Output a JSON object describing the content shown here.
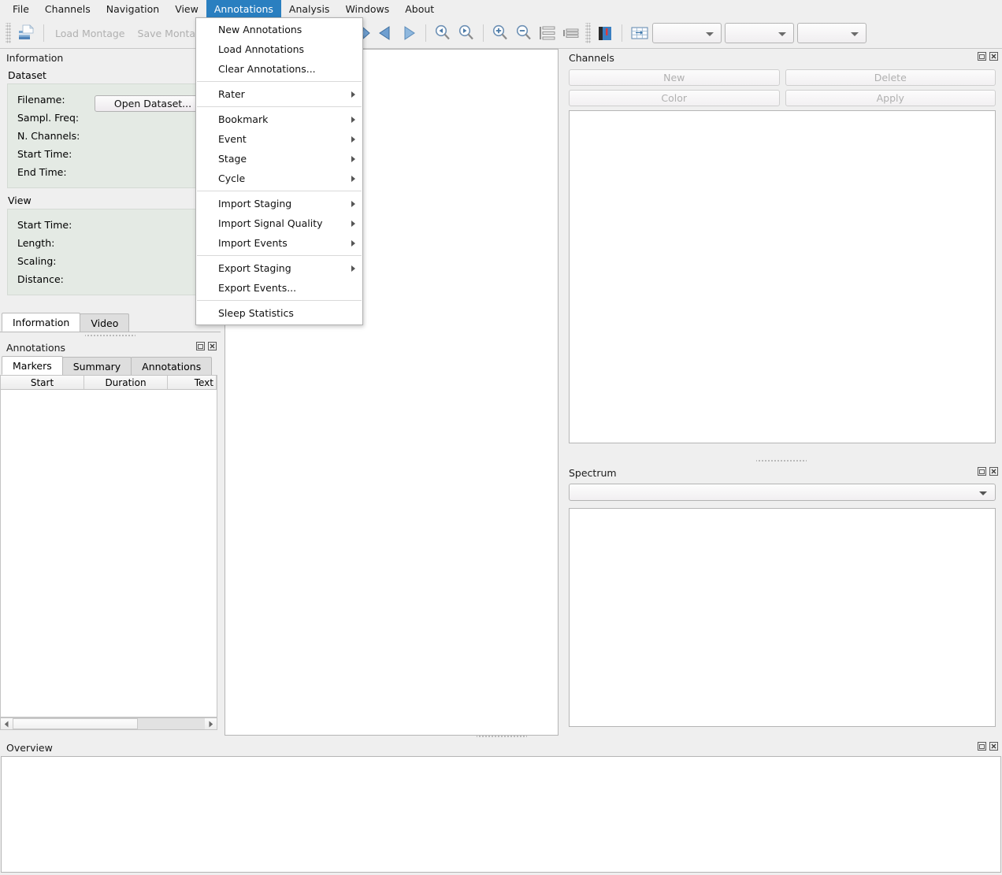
{
  "menubar": {
    "items": [
      {
        "label": "File",
        "active": false
      },
      {
        "label": "Channels",
        "active": false
      },
      {
        "label": "Navigation",
        "active": false
      },
      {
        "label": "View",
        "active": false
      },
      {
        "label": "Annotations",
        "active": true
      },
      {
        "label": "Analysis",
        "active": false
      },
      {
        "label": "Windows",
        "active": false
      },
      {
        "label": "About",
        "active": false
      }
    ],
    "highlight_color": "#2a7fc0"
  },
  "dropdown": {
    "title": "Annotations",
    "items": [
      {
        "label": "New Annotations",
        "submenu": false,
        "separator_after": false
      },
      {
        "label": "Load Annotations",
        "submenu": false,
        "separator_after": false
      },
      {
        "label": "Clear Annotations...",
        "submenu": false,
        "separator_after": true
      },
      {
        "label": "Rater",
        "submenu": true,
        "separator_after": true
      },
      {
        "label": "Bookmark",
        "submenu": true,
        "separator_after": false
      },
      {
        "label": "Event",
        "submenu": true,
        "separator_after": false
      },
      {
        "label": "Stage",
        "submenu": true,
        "separator_after": false
      },
      {
        "label": "Cycle",
        "submenu": true,
        "separator_after": true
      },
      {
        "label": "Import Staging",
        "submenu": true,
        "separator_after": false
      },
      {
        "label": "Import Signal Quality",
        "submenu": true,
        "separator_after": false
      },
      {
        "label": "Import Events",
        "submenu": true,
        "separator_after": true
      },
      {
        "label": "Export Staging",
        "submenu": true,
        "separator_after": false
      },
      {
        "label": "Export Events...",
        "submenu": false,
        "separator_after": true
      },
      {
        "label": "Sleep Statistics",
        "submenu": false,
        "separator_after": false
      }
    ]
  },
  "toolbar": {
    "open_dataset_icon": "open-dataset-icon",
    "load_montage_label": "Load Montage",
    "save_montage_label": "Save Montage",
    "annotations_label": "Load Annotations",
    "nav_back_icon": "arrow-left-big-icon",
    "nav_forward_icon": "arrow-right-big-icon",
    "step_back_icon": "triangle-left-icon",
    "step_forward_icon": "triangle-right-icon",
    "page_back_icon": "magnifier-step-back-icon",
    "page_forward_icon": "magnifier-step-forward-icon",
    "zoom_in_icon": "magnifier-plus-icon",
    "zoom_out_icon": "magnifier-minus-icon",
    "more_lines_icon": "lines-expand-icon",
    "less_lines_icon": "lines-collapse-icon",
    "amplitude_icon": "amplitude-bar-icon",
    "grid_icon": "grid-table-icon",
    "combo1_value": "",
    "combo2_value": "",
    "combo3_value": ""
  },
  "info_panel": {
    "title": "Information",
    "dataset": {
      "label": "Dataset",
      "rows": [
        {
          "key": "Filename:",
          "value": ""
        },
        {
          "key": "Sampl. Freq:",
          "value": ""
        },
        {
          "key": "N. Channels:",
          "value": ""
        },
        {
          "key": "Start Time:",
          "value": ""
        },
        {
          "key": "End Time:",
          "value": ""
        }
      ],
      "open_button": "Open Dataset..."
    },
    "view": {
      "label": "View",
      "rows": [
        {
          "key": "Start Time:",
          "value": ""
        },
        {
          "key": "Length:",
          "value": ""
        },
        {
          "key": "Scaling:",
          "value": ""
        },
        {
          "key": "Distance:",
          "value": ""
        }
      ]
    },
    "tabs": [
      {
        "label": "Information",
        "selected": true
      },
      {
        "label": "Video",
        "selected": false
      }
    ]
  },
  "annotations_panel": {
    "title": "Annotations",
    "tabs": [
      {
        "label": "Markers",
        "selected": true
      },
      {
        "label": "Summary",
        "selected": false
      },
      {
        "label": "Annotations",
        "selected": false
      }
    ],
    "table": {
      "columns": [
        "Start",
        "Duration",
        "Text"
      ],
      "rows": []
    }
  },
  "channels_panel": {
    "title": "Channels",
    "buttons": [
      {
        "label": "New",
        "enabled": false
      },
      {
        "label": "Delete",
        "enabled": false
      },
      {
        "label": "Color",
        "enabled": false
      },
      {
        "label": "Apply",
        "enabled": false
      }
    ]
  },
  "spectrum_panel": {
    "title": "Spectrum",
    "channel_select_value": ""
  },
  "overview_panel": {
    "title": "Overview"
  },
  "dock_icons": {
    "float": "float-window-icon",
    "close": "close-icon"
  }
}
